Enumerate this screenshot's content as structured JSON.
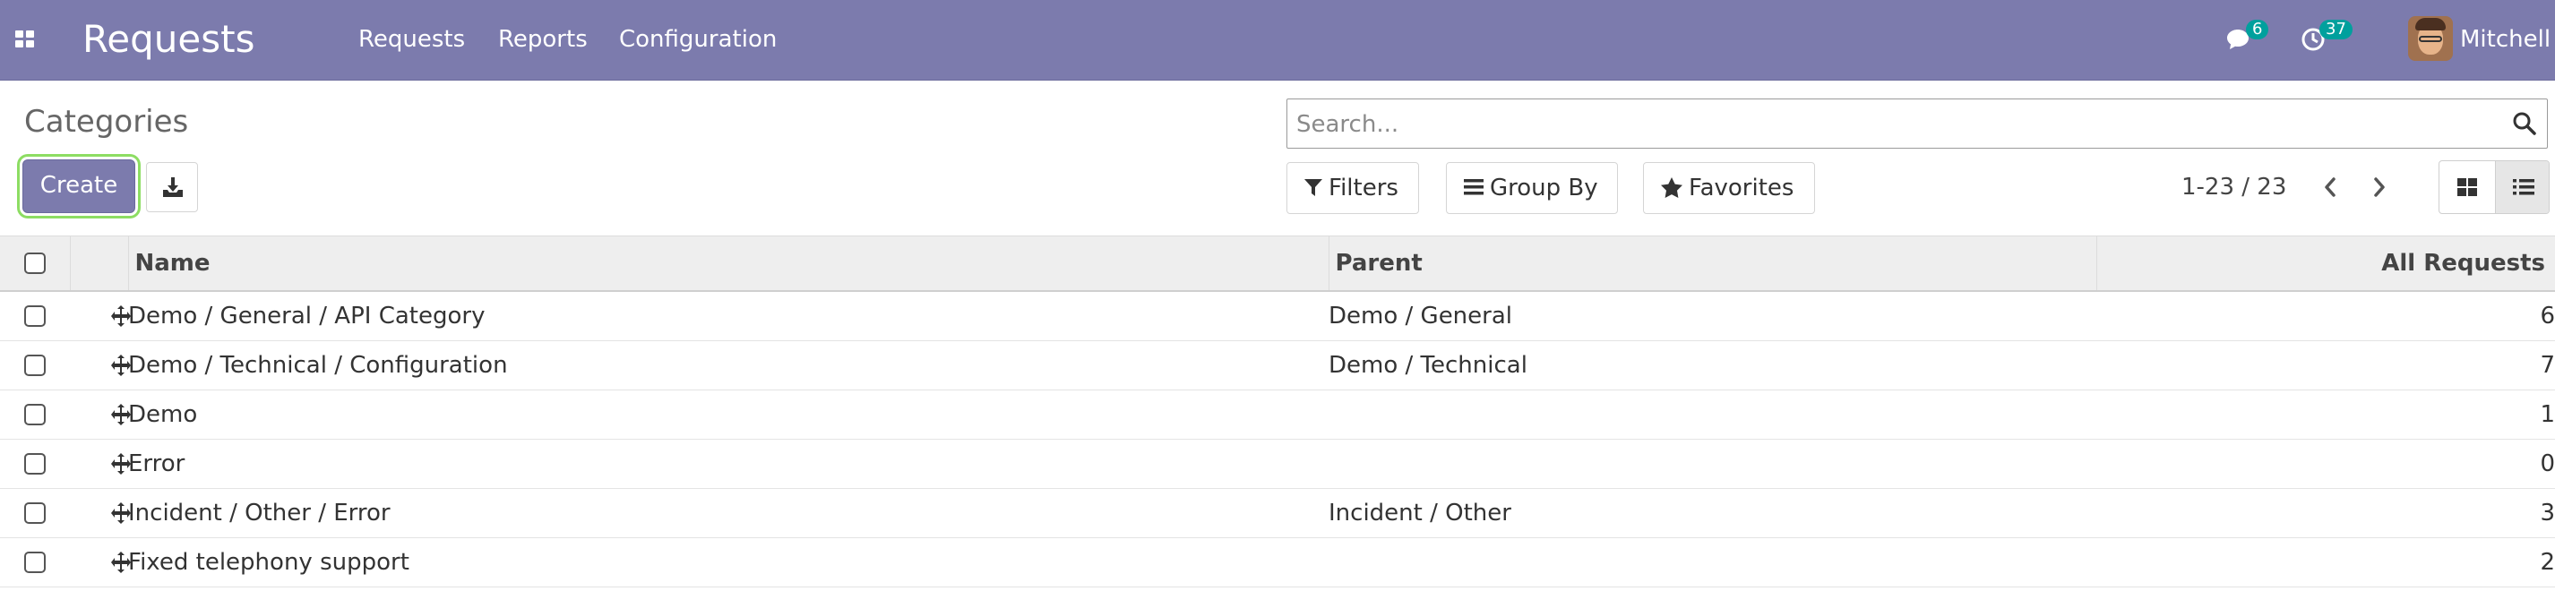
{
  "navbar": {
    "app_title": "Requests",
    "menu": [
      "Requests",
      "Reports",
      "Configuration"
    ],
    "messages_count": "6",
    "activities_count": "37",
    "user_name": "Mitchell",
    "bg_color": "#7c7bad"
  },
  "control_panel": {
    "breadcrumb": "Categories",
    "create_label": "Create",
    "search_placeholder": "Search...",
    "filters_label": "Filters",
    "group_by_label": "Group By",
    "favorites_label": "Favorites",
    "pager_text": "1-23 / 23",
    "accent_color": "#7c7bad"
  },
  "table": {
    "columns": {
      "name": "Name",
      "parent": "Parent",
      "count": "All Requests"
    },
    "rows": [
      {
        "name": "Demo / General / API Category",
        "parent": "Demo / General",
        "count": "6"
      },
      {
        "name": "Demo / Technical / Configuration",
        "parent": "Demo / Technical",
        "count": "7"
      },
      {
        "name": "Demo",
        "parent": "",
        "count": "1"
      },
      {
        "name": "Error",
        "parent": "",
        "count": "0"
      },
      {
        "name": "Incident / Other / Error",
        "parent": "Incident / Other",
        "count": "3"
      },
      {
        "name": "Fixed telephony support",
        "parent": "",
        "count": "2"
      }
    ]
  }
}
